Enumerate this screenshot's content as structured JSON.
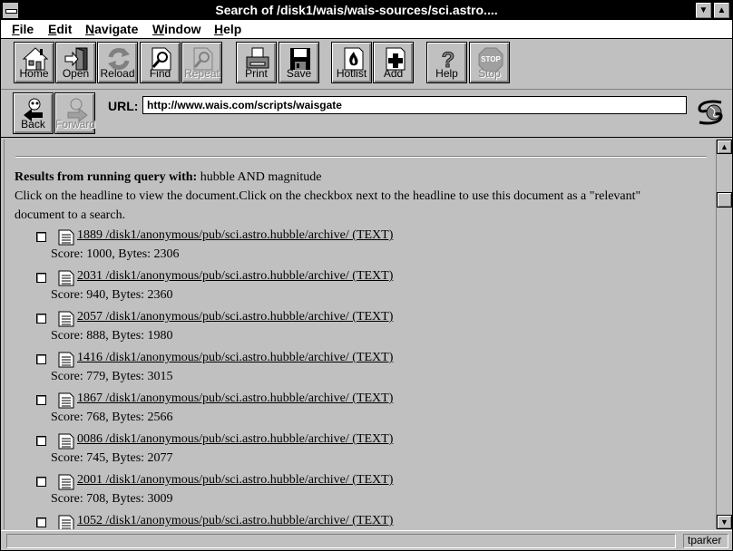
{
  "window": {
    "title": "Search of /disk1/wais/wais-sources/sci.astro...."
  },
  "menu": [
    {
      "label": "File",
      "accel": "F",
      "rest": "ile"
    },
    {
      "label": "Edit",
      "accel": "E",
      "rest": "dit"
    },
    {
      "label": "Navigate",
      "accel": "N",
      "rest": "avigate"
    },
    {
      "label": "Window",
      "accel": "W",
      "rest": "indow"
    },
    {
      "label": "Help",
      "accel": "H",
      "rest": "elp"
    }
  ],
  "toolbar": {
    "home": "Home",
    "open": "Open",
    "reload": "Reload",
    "find": "Find",
    "repeat": "Repeat",
    "print": "Print",
    "save": "Save",
    "hotlist": "Hotlist",
    "add": "Add",
    "help": "Help",
    "stop": "Stop",
    "stop_sign": "STOP",
    "back": "Back",
    "forward": "Forward"
  },
  "url": {
    "label": "URL:",
    "value": "http://www.wais.com/scripts/waisgate"
  },
  "content": {
    "query_prefix": "Results from running query with:",
    "query": "hubble AND magnitude",
    "instructions_1": "Click on the headline to view the document.Click on the checkbox next to the headline to use this document as a \"relevant\"",
    "instructions_2": "document to a search.",
    "results": [
      {
        "link": "1889 /disk1/anonymous/pub/sci.astro.hubble/archive/ (TEXT)",
        "score": "Score: 1000, Bytes: 2306"
      },
      {
        "link": "2031 /disk1/anonymous/pub/sci.astro.hubble/archive/ (TEXT)",
        "score": "Score: 940, Bytes: 2360"
      },
      {
        "link": "2057 /disk1/anonymous/pub/sci.astro.hubble/archive/ (TEXT)",
        "score": "Score: 888, Bytes: 1980"
      },
      {
        "link": "1416 /disk1/anonymous/pub/sci.astro.hubble/archive/ (TEXT)",
        "score": "Score: 779, Bytes: 3015"
      },
      {
        "link": "1867 /disk1/anonymous/pub/sci.astro.hubble/archive/ (TEXT)",
        "score": "Score: 768, Bytes: 2566"
      },
      {
        "link": "0086 /disk1/anonymous/pub/sci.astro.hubble/archive/ (TEXT)",
        "score": "Score: 745, Bytes: 2077"
      },
      {
        "link": "2001 /disk1/anonymous/pub/sci.astro.hubble/archive/ (TEXT)",
        "score": "Score: 708, Bytes: 3009"
      },
      {
        "link": "1052 /disk1/anonymous/pub/sci.astro.hubble/archive/ (TEXT)",
        "score": ""
      }
    ]
  },
  "status": {
    "message": "",
    "user": "tparker"
  },
  "icons": [
    "home-icon",
    "open-icon",
    "reload-icon",
    "find-icon",
    "repeat-icon",
    "print-icon",
    "save-icon",
    "hotlist-icon",
    "add-icon",
    "help-icon",
    "stop-icon",
    "back-icon",
    "forward-icon",
    "globe-icon",
    "document-icon"
  ]
}
